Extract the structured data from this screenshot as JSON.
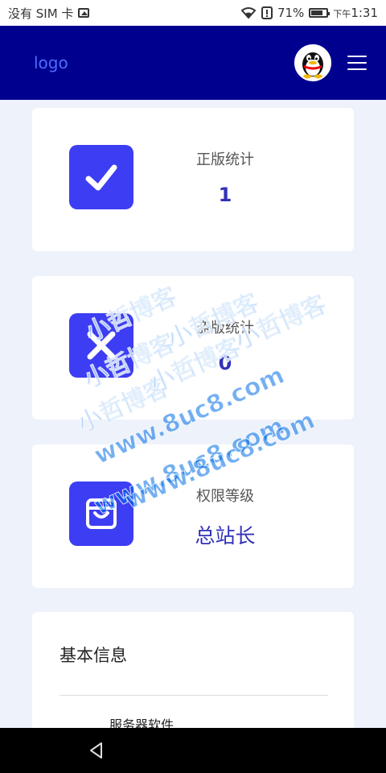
{
  "status_bar": {
    "carrier": "没有 SIM 卡",
    "battery": "71%",
    "time_prefix": "下午",
    "time": "1:31",
    "icons": [
      "image-icon",
      "wifi-icon",
      "alert-icon",
      "battery-icon"
    ]
  },
  "header": {
    "logo": "logo",
    "avatar_icon": "qq-penguin-avatar",
    "menu_icon": "hamburger-menu-icon",
    "bg_color": "#00008f"
  },
  "stats": [
    {
      "label": "正版统计",
      "value": "1",
      "icon": "check-icon"
    },
    {
      "label": "盗版统计",
      "value": "0",
      "icon": "cross-icon"
    },
    {
      "label": "权限等级",
      "value": "总站长",
      "icon": "bag-icon"
    }
  ],
  "info": {
    "title": "基本信息",
    "first_row_label": "服务器软件"
  },
  "watermark": {
    "cn": "小哲博客",
    "url": "www.8uc8.com"
  },
  "nav_bar": {
    "back_icon": "back-triangle-icon"
  },
  "accent_color": "#3d3df3"
}
